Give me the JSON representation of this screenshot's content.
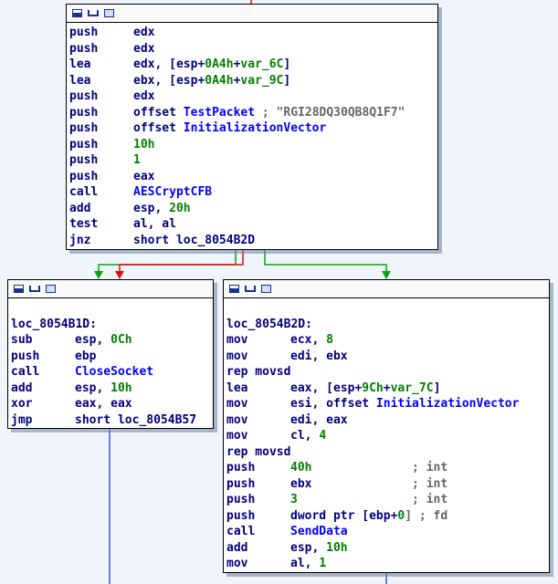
{
  "block_top": {
    "lines": [
      {
        "m": "push",
        "ops": [
          {
            "t": "edx",
            "c": "op"
          }
        ]
      },
      {
        "m": "push",
        "ops": [
          {
            "t": "edx",
            "c": "op"
          }
        ]
      },
      {
        "m": "lea",
        "ops": [
          {
            "t": "edx, [esp+",
            "c": "op"
          },
          {
            "t": "0A4h",
            "c": "num"
          },
          {
            "t": "+",
            "c": "op"
          },
          {
            "t": "var_6C",
            "c": "num"
          },
          {
            "t": "]",
            "c": "op"
          }
        ]
      },
      {
        "m": "lea",
        "ops": [
          {
            "t": "ebx, [esp+",
            "c": "op"
          },
          {
            "t": "0A4h",
            "c": "num"
          },
          {
            "t": "+",
            "c": "op"
          },
          {
            "t": "var_9C",
            "c": "num"
          },
          {
            "t": "]",
            "c": "op"
          }
        ]
      },
      {
        "m": "push",
        "ops": [
          {
            "t": "edx",
            "c": "op"
          }
        ]
      },
      {
        "m": "push",
        "ops": [
          {
            "t": "offset ",
            "c": "op"
          },
          {
            "t": "TestPacket",
            "c": "name"
          },
          {
            "t": " ; \"RGI28DQ30QB8Q1F7\"",
            "c": "cmt"
          }
        ]
      },
      {
        "m": "push",
        "ops": [
          {
            "t": "offset ",
            "c": "op"
          },
          {
            "t": "InitializationVector",
            "c": "name"
          }
        ]
      },
      {
        "m": "push",
        "ops": [
          {
            "t": "10h",
            "c": "num"
          }
        ]
      },
      {
        "m": "push",
        "ops": [
          {
            "t": "1",
            "c": "num"
          }
        ]
      },
      {
        "m": "push",
        "ops": [
          {
            "t": "eax",
            "c": "op"
          }
        ]
      },
      {
        "m": "call",
        "ops": [
          {
            "t": "AESCryptCFB",
            "c": "name"
          }
        ]
      },
      {
        "m": "add",
        "ops": [
          {
            "t": "esp, ",
            "c": "op"
          },
          {
            "t": "20h",
            "c": "num"
          }
        ]
      },
      {
        "m": "test",
        "ops": [
          {
            "t": "al, al",
            "c": "op"
          }
        ]
      },
      {
        "m": "jnz",
        "ops": [
          {
            "t": "short loc_8054B2D",
            "c": "op"
          }
        ]
      }
    ]
  },
  "block_left": {
    "label": "loc_8054B1D:",
    "lines": [
      {
        "m": "sub",
        "ops": [
          {
            "t": "esp, ",
            "c": "op"
          },
          {
            "t": "0Ch",
            "c": "num"
          }
        ]
      },
      {
        "m": "push",
        "ops": [
          {
            "t": "ebp",
            "c": "op"
          }
        ]
      },
      {
        "m": "call",
        "ops": [
          {
            "t": "CloseSocket",
            "c": "name"
          }
        ]
      },
      {
        "m": "add",
        "ops": [
          {
            "t": "esp, ",
            "c": "op"
          },
          {
            "t": "10h",
            "c": "num"
          }
        ]
      },
      {
        "m": "xor",
        "ops": [
          {
            "t": "eax, eax",
            "c": "op"
          }
        ]
      },
      {
        "m": "jmp",
        "ops": [
          {
            "t": "short loc_8054B57",
            "c": "op"
          }
        ]
      }
    ]
  },
  "block_right": {
    "label": "loc_8054B2D:",
    "lines": [
      {
        "m": "mov",
        "ops": [
          {
            "t": "ecx, ",
            "c": "op"
          },
          {
            "t": "8",
            "c": "num"
          }
        ]
      },
      {
        "m": "mov",
        "ops": [
          {
            "t": "edi, ebx",
            "c": "op"
          }
        ]
      },
      {
        "m": "rep movsd",
        "ops": []
      },
      {
        "m": "lea",
        "ops": [
          {
            "t": "eax, [esp+",
            "c": "op"
          },
          {
            "t": "9Ch",
            "c": "num"
          },
          {
            "t": "+",
            "c": "op"
          },
          {
            "t": "var_7C",
            "c": "num"
          },
          {
            "t": "]",
            "c": "op"
          }
        ]
      },
      {
        "m": "mov",
        "ops": [
          {
            "t": "esi, offset ",
            "c": "op"
          },
          {
            "t": "InitializationVector",
            "c": "name"
          }
        ]
      },
      {
        "m": "mov",
        "ops": [
          {
            "t": "edi, eax",
            "c": "op"
          }
        ]
      },
      {
        "m": "mov",
        "ops": [
          {
            "t": "cl, ",
            "c": "op"
          },
          {
            "t": "4",
            "c": "num"
          }
        ]
      },
      {
        "m": "rep movsd",
        "ops": []
      },
      {
        "m": "push",
        "ops": [
          {
            "t": "40h",
            "c": "num"
          },
          {
            "t": "              ; int",
            "c": "cmt"
          }
        ]
      },
      {
        "m": "push",
        "ops": [
          {
            "t": "ebx",
            "c": "op"
          },
          {
            "t": "              ; int",
            "c": "cmt"
          }
        ]
      },
      {
        "m": "push",
        "ops": [
          {
            "t": "3",
            "c": "num"
          },
          {
            "t": "                ; int",
            "c": "cmt"
          }
        ]
      },
      {
        "m": "push",
        "ops": [
          {
            "t": "dword ptr [ebp+",
            "c": "op"
          },
          {
            "t": "0",
            "c": "num"
          },
          {
            "t": "] ; fd",
            "c": "cmt"
          }
        ]
      },
      {
        "m": "call",
        "ops": [
          {
            "t": "SendData",
            "c": "name"
          }
        ]
      },
      {
        "m": "add",
        "ops": [
          {
            "t": "esp, ",
            "c": "op"
          },
          {
            "t": "10h",
            "c": "num"
          }
        ]
      },
      {
        "m": "mov",
        "ops": [
          {
            "t": "al, ",
            "c": "op"
          },
          {
            "t": "1",
            "c": "num"
          }
        ]
      }
    ]
  },
  "colors": {
    "true_edge": "#11a011",
    "false_edge": "#e01010",
    "flow_edge": "#4050e0"
  }
}
